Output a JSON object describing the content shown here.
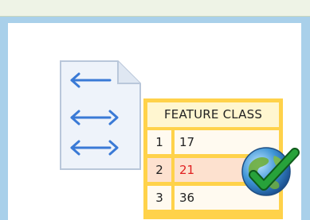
{
  "feature_class": {
    "title": "FEATURE CLASS",
    "rows": [
      {
        "index": "1",
        "value": "17"
      },
      {
        "index": "2",
        "value": "21",
        "highlighted": true
      },
      {
        "index": "3",
        "value": "36"
      }
    ]
  },
  "icons": {
    "document": "document-with-arrows-icon",
    "globe_check": "globe-checkmark-icon"
  },
  "colors": {
    "background": "#a9d0ea",
    "table_border": "#ffd24a",
    "highlight_row": "#fde1cf",
    "highlight_text": "#e02020",
    "check": "#1f9a2c"
  }
}
